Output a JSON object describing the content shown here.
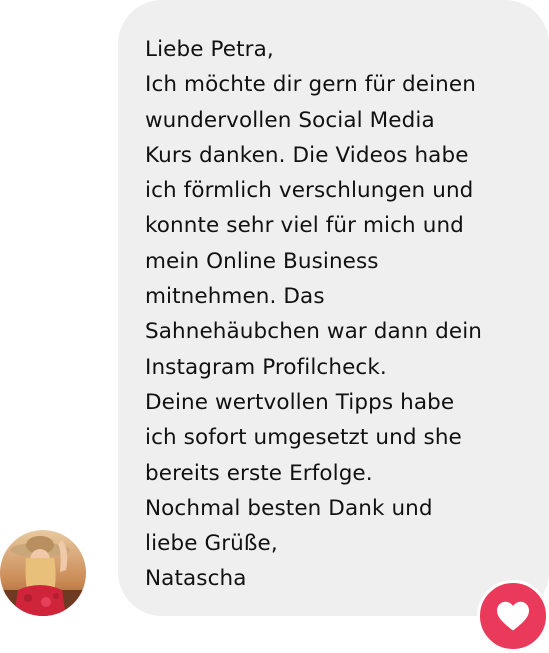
{
  "message": {
    "lines": [
      "Liebe Petra,",
      "Ich möchte dir gern für deinen",
      "wundervollen Social Media",
      "Kurs danken. Die Videos habe",
      "ich förmlich verschlungen und",
      "konnte sehr viel für mich und",
      "mein Online Business",
      "mitnehmen. Das",
      "Sahnehäubchen war dann dein",
      "Instagram Profilcheck.",
      "Deine wertvollen Tipps habe",
      "ich sofort umgesetzt und she",
      "bereits erste Erfolge.",
      "Nochmal besten Dank und",
      "liebe Grüße,",
      "Natascha"
    ]
  },
  "reaction": {
    "icon": "heart-icon",
    "color": "#ea3a5c"
  },
  "avatar": {
    "icon": "profile-photo"
  },
  "colors": {
    "bubble": "#efefef",
    "text": "#111111"
  }
}
